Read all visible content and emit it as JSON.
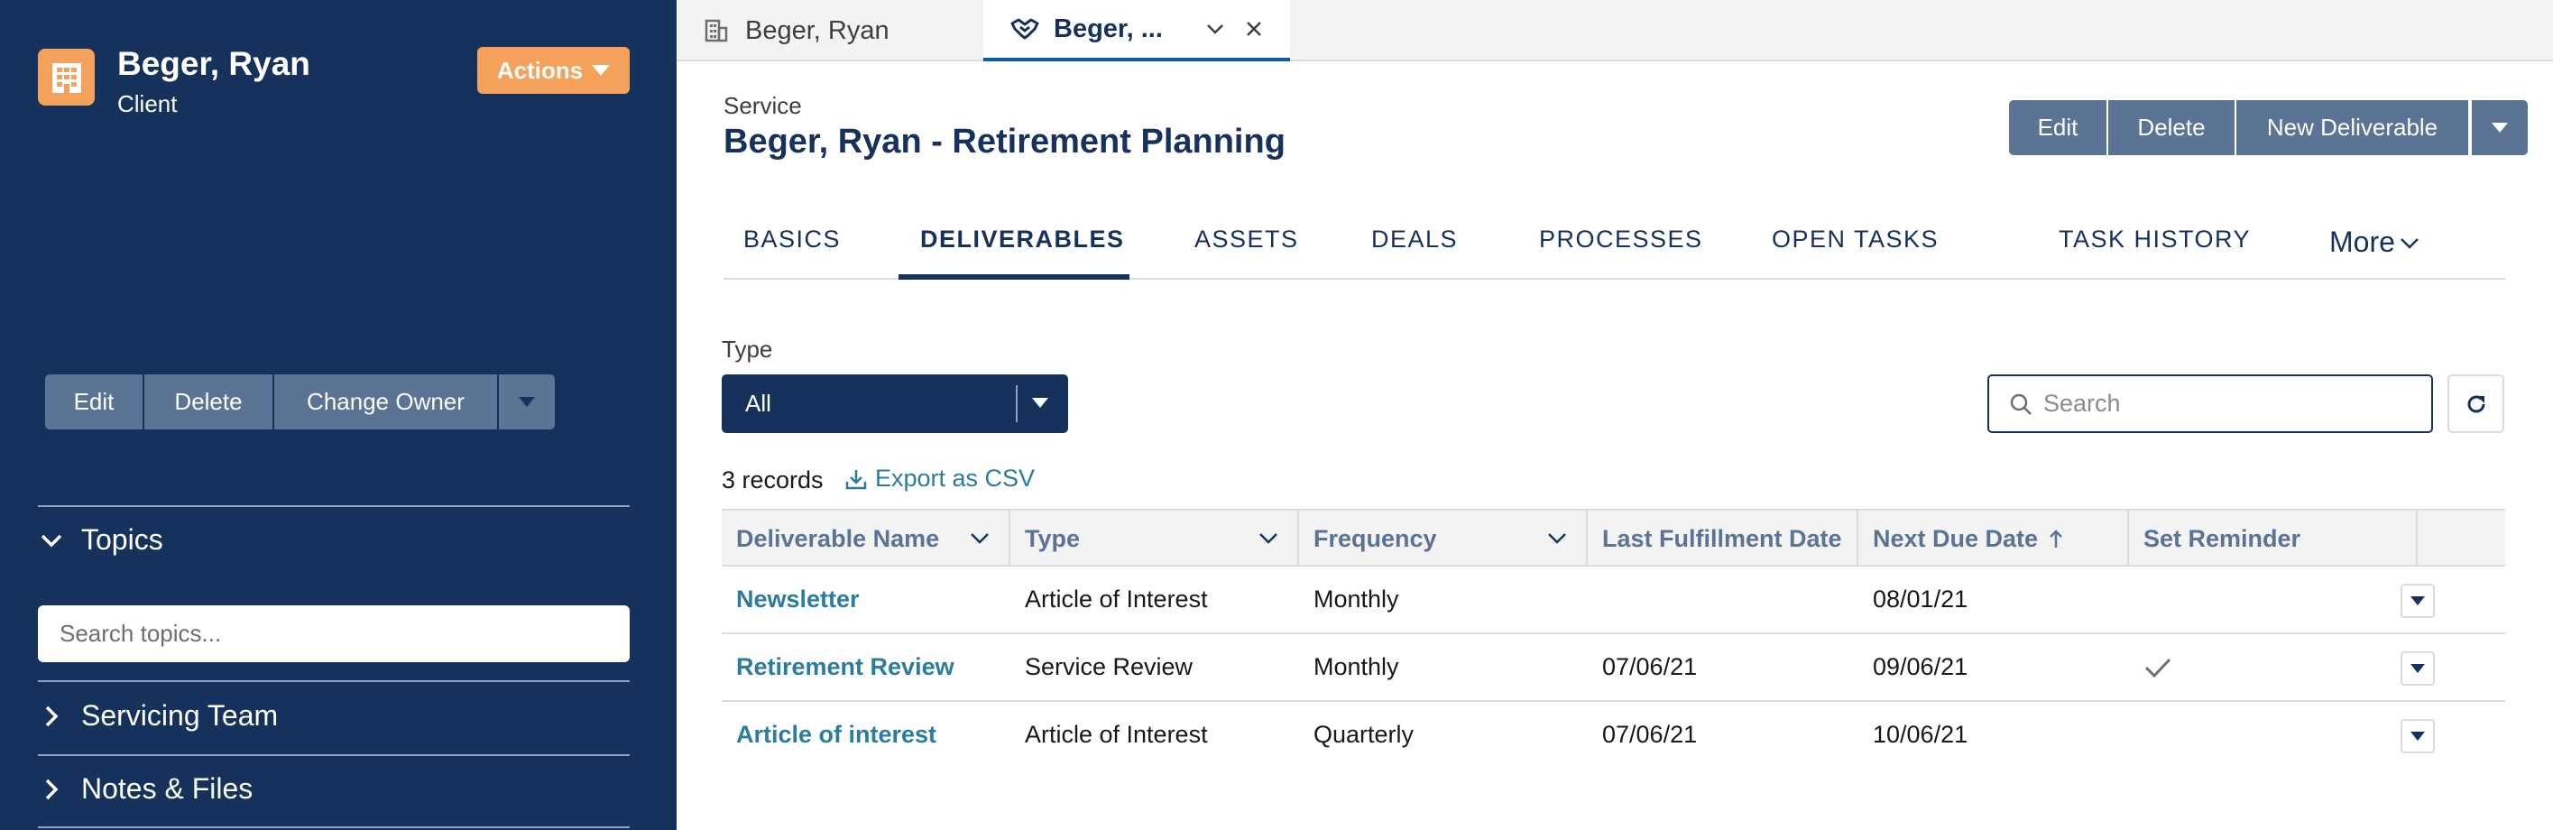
{
  "sidebar": {
    "client_name": "Beger, Ryan",
    "client_type": "Client",
    "actions_label": "Actions",
    "buttons": {
      "edit": "Edit",
      "delete": "Delete",
      "change_owner": "Change Owner"
    },
    "sections": {
      "topics": "Topics",
      "servicing_team": "Servicing Team",
      "notes_files": "Notes & Files"
    },
    "topic_search_placeholder": "Search topics..."
  },
  "tabs": [
    {
      "label": "Beger, Ryan",
      "icon": "building-icon"
    },
    {
      "label": "Beger, ...",
      "icon": "handshake-icon",
      "active": true
    }
  ],
  "record": {
    "object_label": "Service",
    "title": "Beger, Ryan - Retirement Planning",
    "actions": {
      "edit": "Edit",
      "delete": "Delete",
      "new_deliverable": "New Deliverable"
    }
  },
  "subtabs": [
    "BASICS",
    "DELIVERABLES",
    "ASSETS",
    "DEALS",
    "PROCESSES",
    "OPEN TASKS",
    "TASK HISTORY"
  ],
  "subtab_more": "More",
  "active_subtab": "DELIVERABLES",
  "filter": {
    "type_label": "Type",
    "type_value": "All",
    "search_placeholder": "Search"
  },
  "records_count": "3 records",
  "export_label": "Export as CSV",
  "table": {
    "columns": [
      "Deliverable Name",
      "Type",
      "Frequency",
      "Last Fulfillment Date",
      "Next Due Date",
      "Set Reminder"
    ],
    "rows": [
      {
        "name": "Newsletter",
        "type": "Article of Interest",
        "frequency": "Monthly",
        "last_fulfillment": "",
        "next_due": "08/01/21",
        "reminder": false
      },
      {
        "name": "Retirement Review",
        "type": "Service Review",
        "frequency": "Monthly",
        "last_fulfillment": "07/06/21",
        "next_due": "09/06/21",
        "reminder": true
      },
      {
        "name": "Article of interest",
        "type": "Article of Interest",
        "frequency": "Quarterly",
        "last_fulfillment": "07/06/21",
        "next_due": "10/06/21",
        "reminder": false
      }
    ]
  },
  "colors": {
    "sidebar_bg": "#16325c",
    "accent_orange": "#f4a25b",
    "button_slate": "#5b7395",
    "link": "#2b7c9e"
  }
}
